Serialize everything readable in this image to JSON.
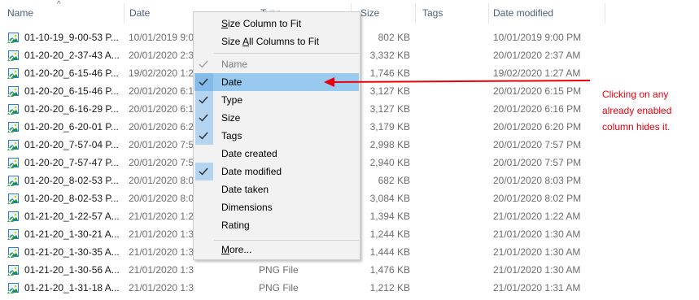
{
  "columns": {
    "name": "Name",
    "date": "Date",
    "type": "Type",
    "size": "Size",
    "tags": "Tags",
    "date_modified": "Date modified"
  },
  "files": [
    {
      "name": "01-10-19_9-00-53 P...",
      "date": "10/01/2019 9:00",
      "size": "802 KB",
      "modified": "10/01/2019 9:00 PM"
    },
    {
      "name": "01-20-20_2-37-43 A...",
      "date": "20/01/2020 2:37",
      "size": "3,332 KB",
      "modified": "20/01/2020 2:37 AM"
    },
    {
      "name": "01-20-20_6-15-46 P...",
      "date": "19/02/2020 1:24",
      "size": "1,746 KB",
      "modified": "19/02/2020 1:27 AM"
    },
    {
      "name": "01-20-20_6-15-46 P...",
      "date": "20/01/2020 6:15",
      "size": "3,127 KB",
      "modified": "20/01/2020 6:15 PM"
    },
    {
      "name": "01-20-20_6-16-29 P...",
      "date": "20/01/2020 6:16",
      "size": "3,127 KB",
      "modified": "20/01/2020 6:16 PM"
    },
    {
      "name": "01-20-20_6-20-01 P...",
      "date": "20/01/2020 6:20",
      "size": "3,179 KB",
      "modified": "20/01/2020 6:20 PM"
    },
    {
      "name": "01-20-20_7-57-04 P...",
      "date": "20/01/2020 7:57",
      "size": "2,998 KB",
      "modified": "20/01/2020 7:57 PM"
    },
    {
      "name": "01-20-20_7-57-47 P...",
      "date": "20/01/2020 7:57",
      "size": "2,940 KB",
      "modified": "20/01/2020 7:57 PM"
    },
    {
      "name": "01-20-20_8-02-53 P...",
      "date": "20/01/2020 8:03",
      "size": "682 KB",
      "modified": "20/01/2020 8:03 PM"
    },
    {
      "name": "01-20-20_8-02-53 P...",
      "date": "20/01/2020 8:02",
      "size": "3,084 KB",
      "modified": "20/01/2020 8:02 PM"
    },
    {
      "name": "01-21-20_1-22-57 A...",
      "date": "21/01/2020 1:22",
      "size": "1,394 KB",
      "modified": "21/01/2020 1:22 AM"
    },
    {
      "name": "01-21-20_1-30-21 A...",
      "date": "21/01/2020 1:30",
      "size": "1,244 KB",
      "modified": "21/01/2020 1:30 AM"
    },
    {
      "name": "01-21-20_1-30-35 A...",
      "date": "21/01/2020 1:30",
      "size": "1,444 KB",
      "modified": "21/01/2020 1:30 AM"
    },
    {
      "name": "01-21-20_1-30-56 A...",
      "date": "21/01/2020 1:30 AM",
      "type": "PNG File",
      "size": "1,476 KB",
      "modified": "21/01/2020 1:30 AM"
    },
    {
      "name": "01-21-20_1-31-18 A...",
      "date": "21/01/2020 1:31 AM",
      "type": "PNG File",
      "size": "1,212 KB",
      "modified": "21/01/2020 1:31 AM"
    }
  ],
  "menu": {
    "size_column_to_fit": "Size Column to Fit",
    "size_all_columns_to_fit": "Size All Columns to Fit",
    "items": [
      {
        "label": "Name",
        "checked": true,
        "disabled": true
      },
      {
        "label": "Date",
        "checked": true,
        "highlighted": true
      },
      {
        "label": "Type",
        "checked": true
      },
      {
        "label": "Size",
        "checked": true
      },
      {
        "label": "Tags",
        "checked": true
      },
      {
        "label": "Date created",
        "checked": false
      },
      {
        "label": "Date modified",
        "checked": true
      },
      {
        "label": "Date taken",
        "checked": false
      },
      {
        "label": "Dimensions",
        "checked": false
      },
      {
        "label": "Rating",
        "checked": false
      }
    ],
    "more": "More..."
  },
  "annotation": {
    "text": "Clicking on any already enabled column hides it.",
    "color": "#e8000b"
  },
  "colors": {
    "highlight": "#99c9ef",
    "check_bg": "#b3d5f2",
    "header_text": "#4c607a",
    "arrow": "#e8000b"
  },
  "icons": {
    "file_icon": "image-file-icon",
    "check": "checkmark-icon",
    "sort": "sort-up-icon"
  }
}
